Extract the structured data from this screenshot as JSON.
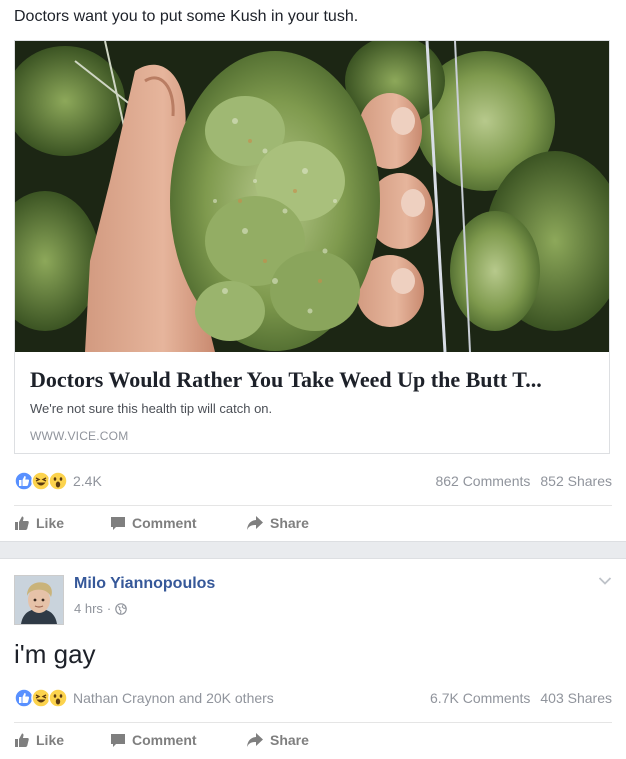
{
  "post1": {
    "caption": "Doctors want you to put some Kush in your tush.",
    "link": {
      "title": "Doctors Would Rather You Take Weed Up the Butt T...",
      "description": "We're not sure this health tip will catch on.",
      "domain": "WWW.VICE.COM"
    },
    "reactions": {
      "icons": [
        "like-icon",
        "haha-icon",
        "wow-icon"
      ],
      "count": "2.4K",
      "comments": "862 Comments",
      "shares": "852 Shares"
    },
    "actions": {
      "like": "Like",
      "comment": "Comment",
      "share": "Share"
    }
  },
  "post2": {
    "author": "Milo Yiannopoulos",
    "time": "4 hrs",
    "separator": "·",
    "privacy_icon": "globe-icon",
    "status": "i'm gay",
    "reactions": {
      "icons": [
        "like-icon",
        "haha-icon",
        "wow-icon"
      ],
      "summary": "Nathan Craynon and 20K others",
      "comments": "6.7K Comments",
      "shares": "403 Shares"
    },
    "actions": {
      "like": "Like",
      "comment": "Comment",
      "share": "Share"
    }
  },
  "colors": {
    "link_blue": "#365899",
    "meta_gray": "#90949c",
    "like_blue": "#5890ff",
    "emoji_yellow": "#fcd34d"
  }
}
